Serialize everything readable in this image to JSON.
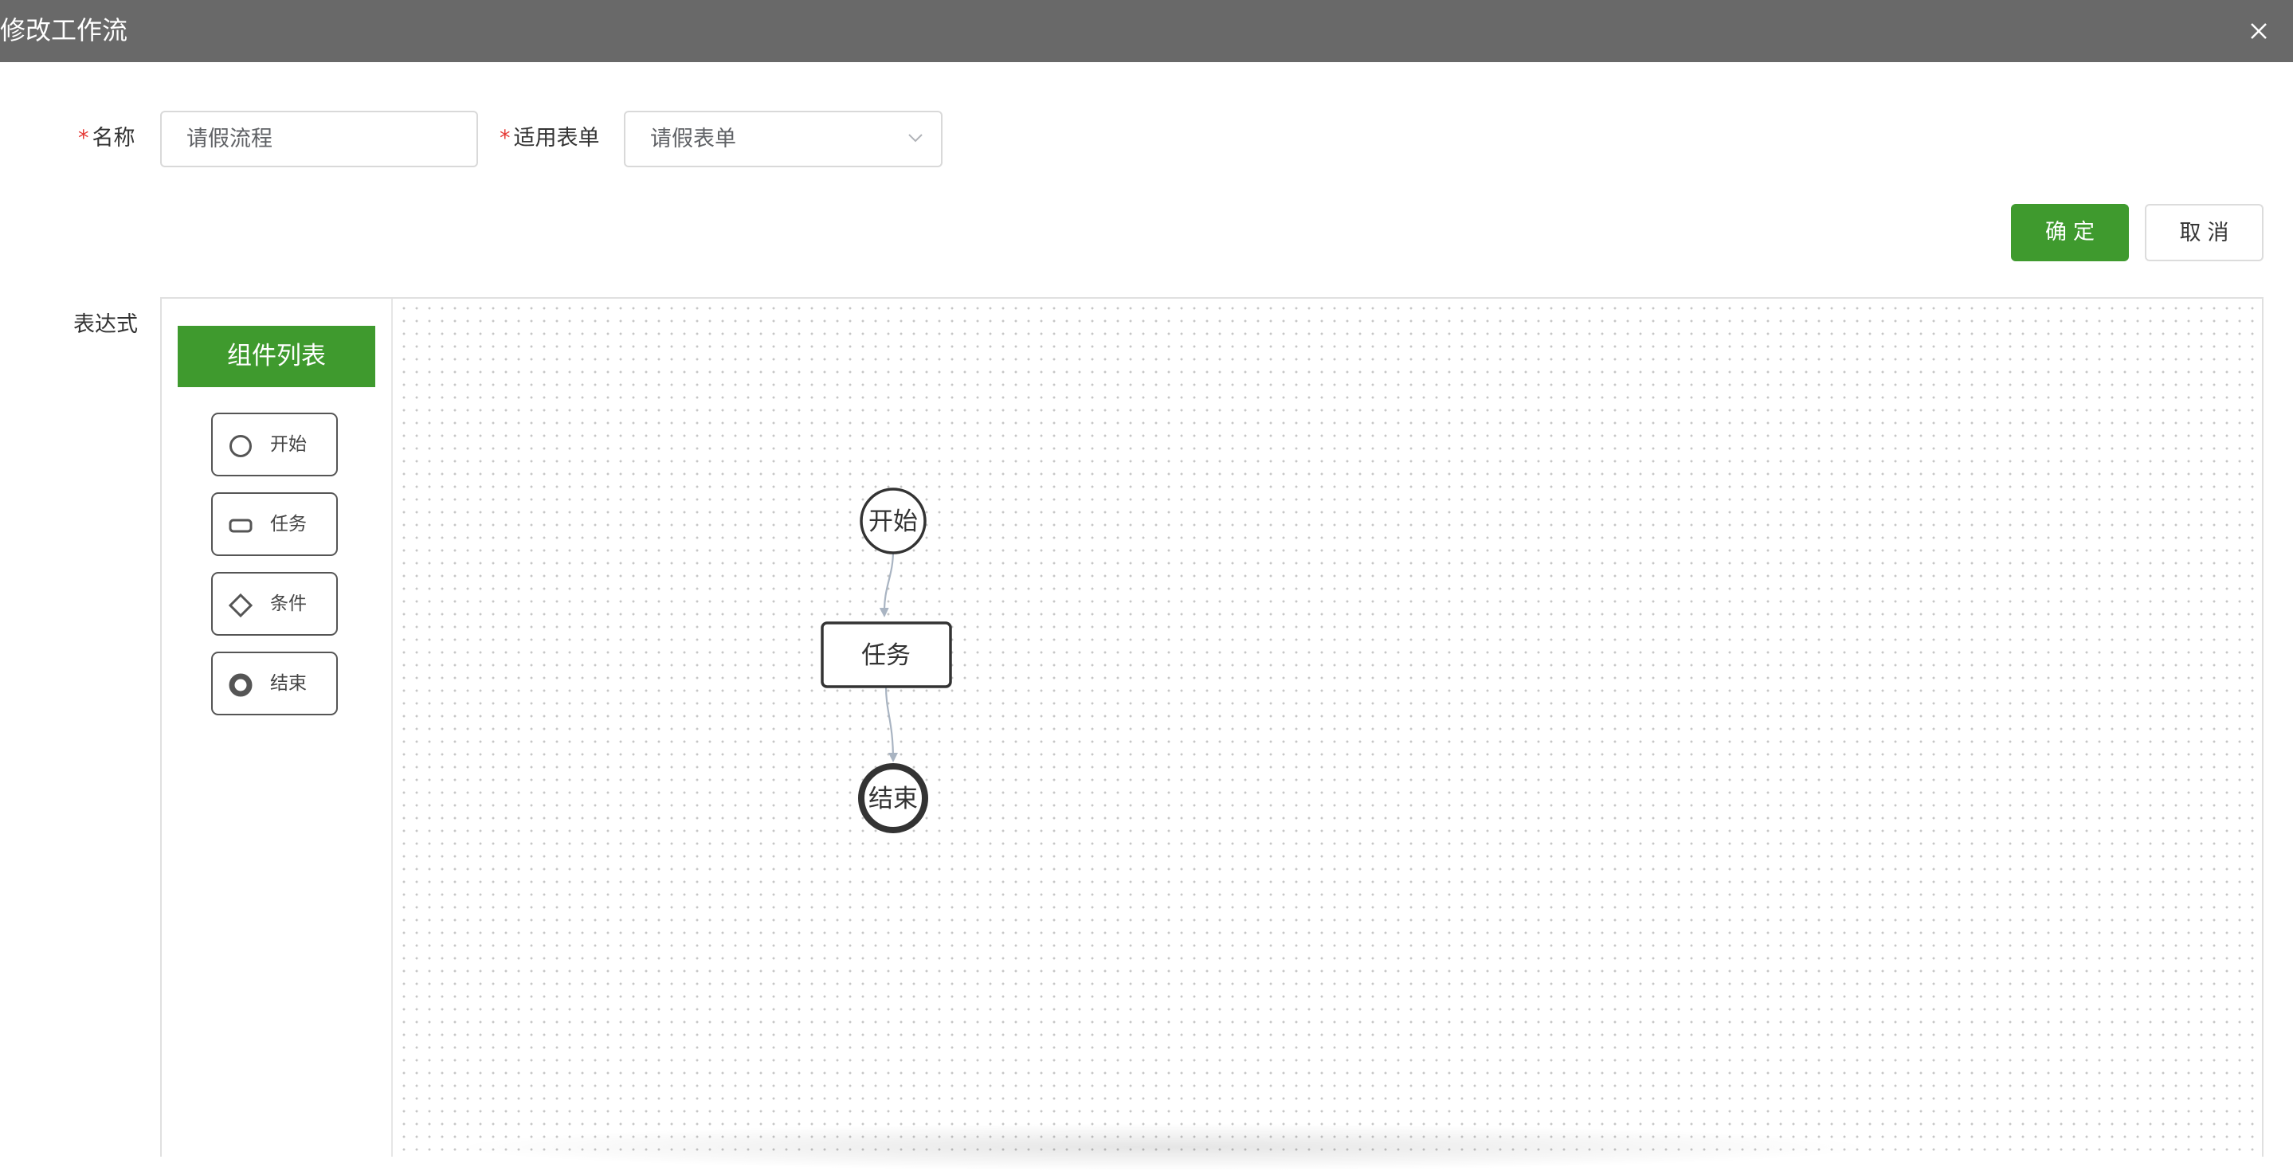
{
  "dialog": {
    "title": "修改工作流"
  },
  "form": {
    "name": {
      "required_mark": "*",
      "label": "名称",
      "value": "请假流程"
    },
    "form_select": {
      "required_mark": "*",
      "label": "适用表单",
      "value": "请假表单"
    },
    "expression_label": "表达式"
  },
  "actions": {
    "confirm_label": "确定",
    "cancel_label": "取消"
  },
  "palette": {
    "header": "组件列表",
    "items": [
      {
        "label": "开始",
        "icon": "circle-outline-icon"
      },
      {
        "label": "任务",
        "icon": "rounded-rect-icon"
      },
      {
        "label": "条件",
        "icon": "diamond-icon"
      },
      {
        "label": "结束",
        "icon": "bold-circle-icon"
      }
    ]
  },
  "flow": {
    "nodes": [
      {
        "id": "start",
        "type": "start",
        "label": "开始"
      },
      {
        "id": "task",
        "type": "task",
        "label": "任务"
      },
      {
        "id": "end",
        "type": "end",
        "label": "结束"
      }
    ],
    "edges": [
      {
        "from": "start",
        "to": "task"
      },
      {
        "from": "task",
        "to": "end"
      }
    ]
  },
  "colors": {
    "primary": "#3f9a2e",
    "titlebar": "#696969",
    "required": "#e53935",
    "edge": "#a9b4c2"
  }
}
